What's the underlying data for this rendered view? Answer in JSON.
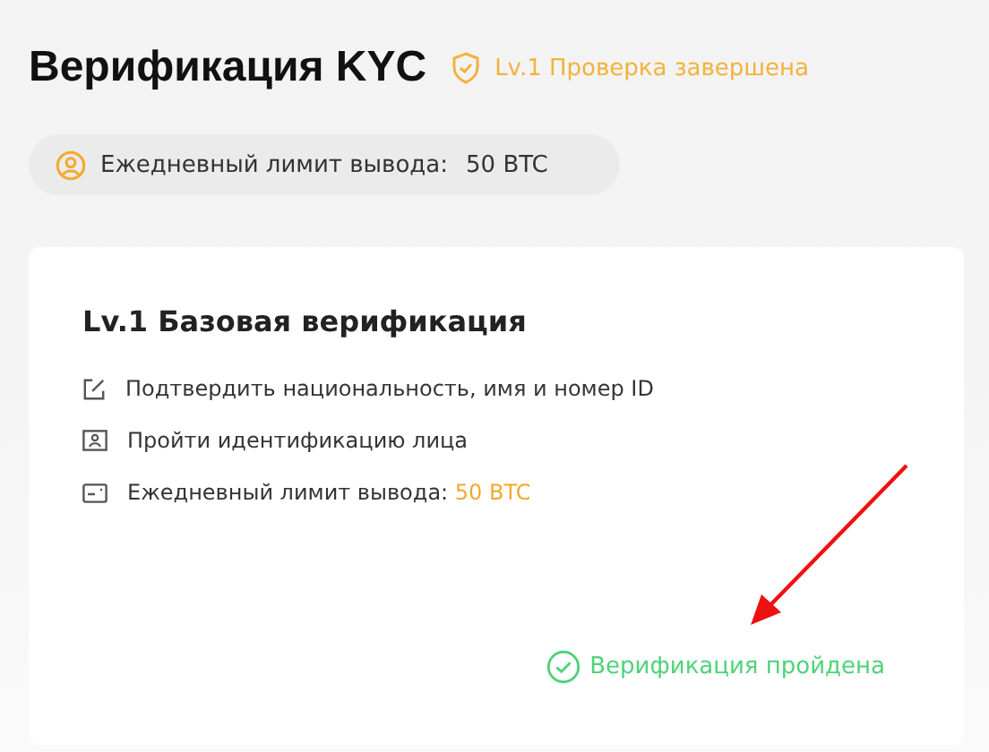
{
  "header": {
    "title": "Верификация KYC",
    "status": "Lv.1 Проверка завершена"
  },
  "limit_pill": {
    "label": "Ежедневный лимит вывода:",
    "value": "50 BTC"
  },
  "card": {
    "title": "Lv.1 Базовая верификация",
    "items": [
      {
        "kind": "edit",
        "text": "Подтвердить национальность, имя и номер ID"
      },
      {
        "kind": "face",
        "text": "Пройти идентификацию лица"
      },
      {
        "kind": "card",
        "text": "Ежедневный лимит вывода:",
        "highlight": "50 BTC"
      }
    ],
    "result": {
      "text": "Верификация пройдена",
      "passed": true
    }
  },
  "annotation": {
    "kind": "arrow"
  }
}
